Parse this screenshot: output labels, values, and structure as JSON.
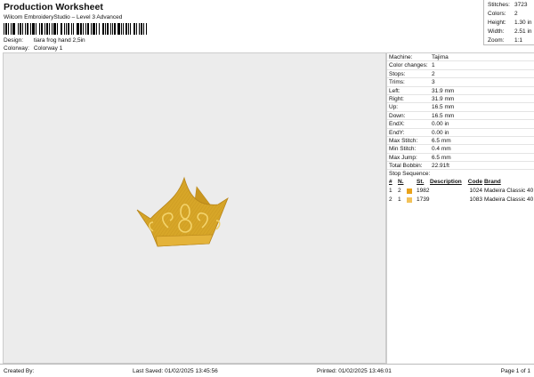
{
  "header": {
    "title": "Production Worksheet",
    "subtitle": "Wilcom EmbroideryStudio – Level 3 Advanced",
    "design_label": "Design:",
    "design_value": "tiara frog hand 2,5in",
    "colorway_label": "Colorway:",
    "colorway_value": "Colorway 1"
  },
  "stats": [
    {
      "label": "Stitches:",
      "value": "3723"
    },
    {
      "label": "Colors:",
      "value": "2"
    },
    {
      "label": "Height:",
      "value": "1.30 in"
    },
    {
      "label": "Width:",
      "value": "2.51 in"
    },
    {
      "label": "Zoom:",
      "value": "1:1"
    }
  ],
  "machine_info": [
    {
      "label": "Machine:",
      "value": "Tajima"
    },
    {
      "label": "Color changes:",
      "value": "1"
    },
    {
      "label": "Stops:",
      "value": "2"
    },
    {
      "label": "Trims:",
      "value": "3"
    },
    {
      "label": "Left:",
      "value": "31.9 mm"
    },
    {
      "label": "Right:",
      "value": "31.9 mm"
    },
    {
      "label": "Up:",
      "value": "16.5 mm"
    },
    {
      "label": "Down:",
      "value": "16.5 mm"
    },
    {
      "label": "EndX:",
      "value": "0.00 in"
    },
    {
      "label": "EndY:",
      "value": "0.00 in"
    },
    {
      "label": "Max Stitch:",
      "value": "6.5 mm"
    },
    {
      "label": "Min Stitch:",
      "value": "0.4 mm"
    },
    {
      "label": "Max Jump:",
      "value": "6.5 mm"
    },
    {
      "label": "Total Bobbin:",
      "value": "22.91ft"
    }
  ],
  "stop_sequence": {
    "title": "Stop Sequence:",
    "columns": [
      "#",
      "N.",
      "",
      "St.",
      "Description",
      "Code",
      "Brand"
    ],
    "rows": [
      {
        "num": "1",
        "n": "2",
        "color": "#e8a21a",
        "st": "1982",
        "desc": "",
        "code": "1024",
        "brand": "Madeira Classic 40"
      },
      {
        "num": "2",
        "n": "1",
        "color": "#f2c25a",
        "st": "1739",
        "desc": "",
        "code": "1083",
        "brand": "Madeira Classic 40"
      }
    ]
  },
  "footer": {
    "created_by": "Created By:",
    "last_saved": "Last Saved: 01/02/2025 13:45:56",
    "printed": "Printed: 01/02/2025 13:46:01",
    "page": "Page 1 of 1"
  },
  "colors": {
    "crown_fill": "#d9a92a",
    "crown_dark": "#b8861b",
    "crown_line": "#f3d36b"
  }
}
